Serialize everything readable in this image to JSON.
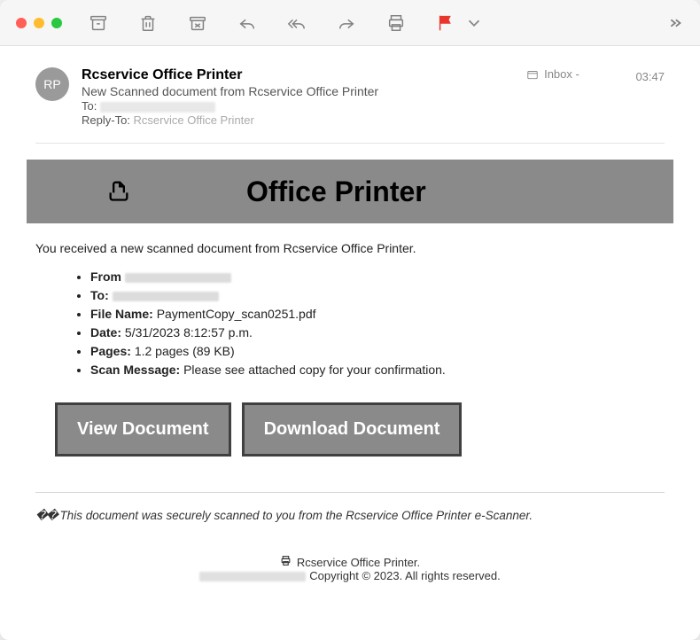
{
  "header": {
    "avatar_initials": "RP",
    "sender": "Rcservice Office Printer",
    "subject": "New Scanned document from Rcservice Office Printer",
    "to_label": "To:",
    "reply_to_label": "Reply-To:",
    "reply_to_value": "Rcservice Office Printer",
    "folder_label": "Inbox -",
    "time": "03:47"
  },
  "banner": {
    "title": "Office Printer"
  },
  "body": {
    "intro": "You received a new scanned document from Rcservice Office Printer.",
    "from_label": "From",
    "to_label": "To:",
    "filename_label": "File Name:",
    "filename_value": "PaymentCopy_scan0251.pdf",
    "date_label": "Date:",
    "date_value": "5/31/2023 8:12:57 p.m.",
    "pages_label": "Pages:",
    "pages_value": "1.2 pages (89 KB)",
    "scanmsg_label": "Scan Message:",
    "scanmsg_value": "Please see attached copy for your confirmation."
  },
  "buttons": {
    "view": "View Document",
    "download": "Download Document"
  },
  "secure_note": {
    "prefix": "��",
    "text": " This document was securely scanned to you from the Rcservice Office Printer e-Scanner."
  },
  "footer": {
    "line1": "Rcservice Office Printer.",
    "line2": "Copyright © 2023. All rights reserved."
  }
}
